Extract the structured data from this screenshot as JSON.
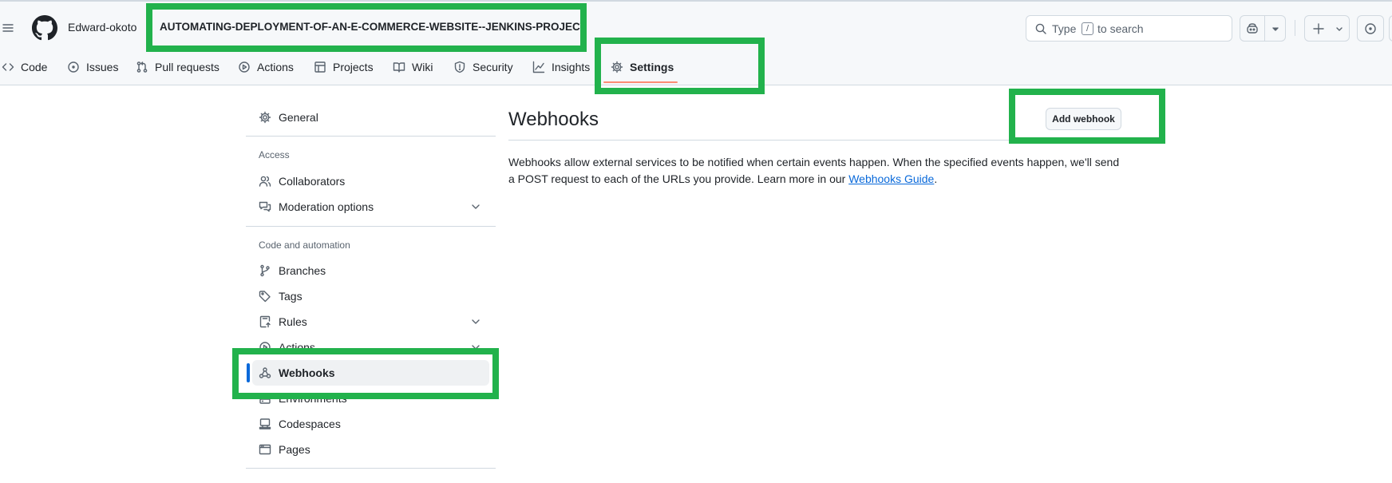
{
  "header": {
    "owner": "Edward-okoto",
    "separator": "/",
    "repo": "AUTOMATING-DEPLOYMENT-OF-AN-E-COMMERCE-WEBSITE--JENKINS-PROJECT",
    "search": {
      "prefix": "Type",
      "key": "/",
      "suffix": "to search"
    }
  },
  "repo_nav": {
    "items": [
      {
        "label": "Code",
        "icon": "code-icon"
      },
      {
        "label": "Issues",
        "icon": "issue-icon"
      },
      {
        "label": "Pull requests",
        "icon": "pull-request-icon"
      },
      {
        "label": "Actions",
        "icon": "play-icon"
      },
      {
        "label": "Projects",
        "icon": "table-icon"
      },
      {
        "label": "Wiki",
        "icon": "book-icon"
      },
      {
        "label": "Security",
        "icon": "shield-icon"
      },
      {
        "label": "Insights",
        "icon": "graph-icon"
      },
      {
        "label": "Settings",
        "icon": "gear-icon"
      }
    ],
    "active": "Settings"
  },
  "sidebar": {
    "general": "General",
    "access_heading": "Access",
    "access_items": [
      "Collaborators",
      "Moderation options"
    ],
    "code_heading": "Code and automation",
    "code_items": [
      "Branches",
      "Tags",
      "Rules",
      "Actions",
      "Webhooks",
      "Environments",
      "Codespaces",
      "Pages"
    ],
    "selected": "Webhooks"
  },
  "main": {
    "title": "Webhooks",
    "add_button": "Add webhook",
    "description_before": "Webhooks allow external services to be notified when certain events happen. When the specified events happen, we'll send a POST request to each of the URLs you provide. Learn more in our ",
    "link_text": "Webhooks Guide",
    "description_after": "."
  },
  "colors": {
    "accent_blue": "#0969da",
    "nav_underline": "#fd8c73",
    "annotation_green": "#22b24c"
  }
}
